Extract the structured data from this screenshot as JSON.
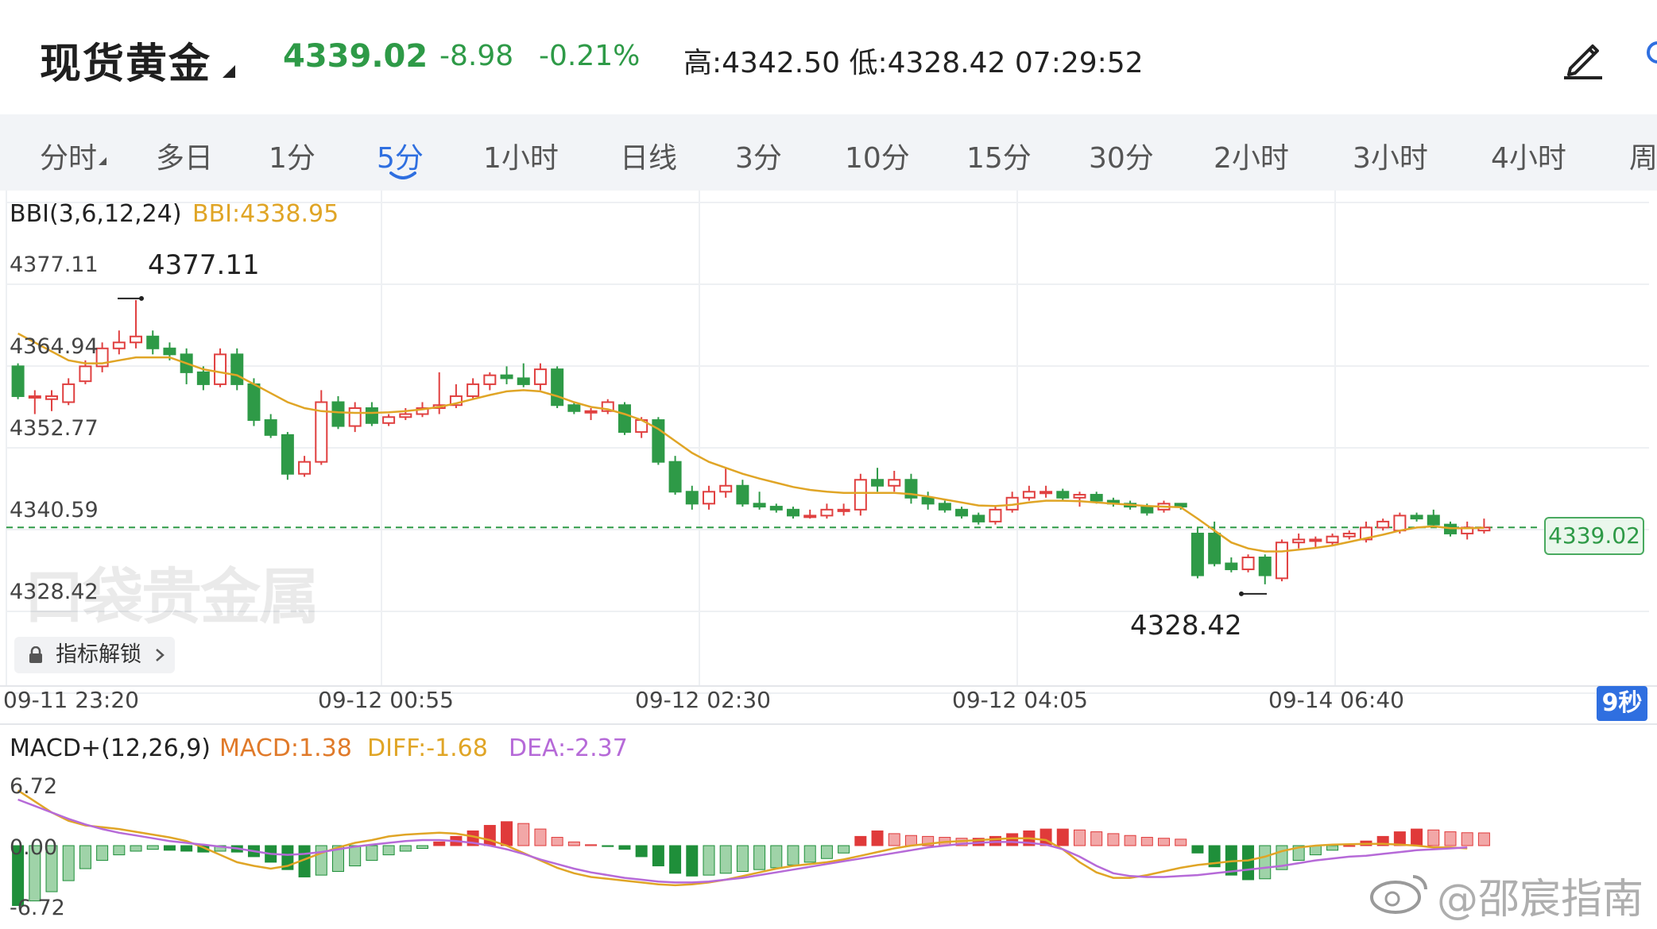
{
  "header": {
    "title": "现货黄金",
    "price": "4339.02",
    "change": "-8.98",
    "change_pct": "-0.21%",
    "high_low_time": "高:4342.50   低:4328.42   07:29:52",
    "colors": {
      "down": "#2e9a47",
      "up": "#e04040"
    }
  },
  "tabs": [
    "分时",
    "多日",
    "1分",
    "5分",
    "1小时",
    "日线",
    "3分",
    "10分",
    "15分",
    "30分",
    "2小时",
    "3小时",
    "4小时",
    "周"
  ],
  "active_tab": "5分",
  "indicator_unlock": "指标解锁",
  "current_price_tag": "4339.02",
  "refresh_badge": "9秒",
  "watermark": "口袋贵金属",
  "weibo_mark": "@邵宸指南",
  "chart_data": {
    "type": "candlestick",
    "bbi_label": "BBI(3,6,12,24)",
    "bbi_value": "BBI:4338.95",
    "y_ticks": [
      "4377.11",
      "4364.94",
      "4352.77",
      "4340.59",
      "4328.42"
    ],
    "ylim": [
      4322.3,
      4383.2
    ],
    "x_ticks": [
      "09-11 23:20",
      "09-12 00:55",
      "09-12 02:30",
      "09-12 04:05",
      "09-14 06:40"
    ],
    "high_label": "4377.11",
    "low_label": "4328.42",
    "last_price": 4339.02,
    "candles": [
      [
        4366,
        4361,
        4366.5,
        4360.5
      ],
      [
        4361,
        4361,
        4362,
        4358
      ],
      [
        4360.5,
        4361,
        4362,
        4358.5
      ],
      [
        4360,
        4363,
        4364,
        4359.5
      ],
      [
        4363.5,
        4366,
        4367,
        4363
      ],
      [
        4366,
        4369,
        4370,
        4365
      ],
      [
        4369,
        4370,
        4372,
        4368
      ],
      [
        4370,
        4371,
        4377.1,
        4369
      ],
      [
        4371,
        4369,
        4372,
        4368
      ],
      [
        4369,
        4368,
        4370,
        4367
      ],
      [
        4368,
        4365,
        4369,
        4363
      ],
      [
        4365,
        4363,
        4366,
        4362
      ],
      [
        4363,
        4368,
        4369,
        4362.5
      ],
      [
        4368,
        4363,
        4369,
        4362
      ],
      [
        4363,
        4357,
        4364,
        4356
      ],
      [
        4357,
        4354.5,
        4358,
        4354
      ],
      [
        4354.5,
        4348,
        4355,
        4347
      ],
      [
        4348,
        4350,
        4351,
        4347.5
      ],
      [
        4350,
        4360,
        4362,
        4349.5
      ],
      [
        4360,
        4356,
        4361,
        4355.5
      ],
      [
        4356,
        4359,
        4360,
        4355
      ],
      [
        4359,
        4356.5,
        4360,
        4356
      ],
      [
        4356.5,
        4357.5,
        4358,
        4356
      ],
      [
        4357.5,
        4358,
        4359,
        4357
      ],
      [
        4358,
        4359,
        4360,
        4357.5
      ],
      [
        4359,
        4359.5,
        4365,
        4358
      ],
      [
        4359.5,
        4361,
        4363,
        4359
      ],
      [
        4361,
        4363,
        4364,
        4360.5
      ],
      [
        4363,
        4364.5,
        4365,
        4362
      ],
      [
        4364.5,
        4364,
        4366,
        4363
      ],
      [
        4364,
        4363,
        4366.5,
        4362.5
      ],
      [
        4363,
        4365.5,
        4366.5,
        4362
      ],
      [
        4365.5,
        4359.5,
        4366,
        4359
      ],
      [
        4359.5,
        4358.5,
        4360,
        4358
      ],
      [
        4358.5,
        4358.5,
        4359,
        4357
      ],
      [
        4358.5,
        4360,
        4360.5,
        4358
      ],
      [
        4359.5,
        4355,
        4360,
        4354.5
      ],
      [
        4355,
        4357,
        4357.5,
        4354
      ],
      [
        4357,
        4350,
        4357.5,
        4349.5
      ],
      [
        4350,
        4345,
        4351,
        4344.5
      ],
      [
        4345,
        4343,
        4346,
        4342
      ],
      [
        4343,
        4345,
        4346,
        4342
      ],
      [
        4345,
        4346,
        4349,
        4344
      ],
      [
        4346,
        4343,
        4347,
        4342.5
      ],
      [
        4343,
        4342.5,
        4345,
        4342
      ],
      [
        4342.5,
        4342,
        4343,
        4341.5
      ],
      [
        4342,
        4341,
        4342.5,
        4340.5
      ],
      [
        4341,
        4341,
        4342,
        4340.5
      ],
      [
        4341,
        4342,
        4343,
        4340.5
      ],
      [
        4342,
        4342,
        4343,
        4341
      ],
      [
        4342,
        4347,
        4348,
        4341
      ],
      [
        4347,
        4346,
        4349,
        4345
      ],
      [
        4346,
        4347,
        4348.5,
        4345
      ],
      [
        4347,
        4344,
        4348,
        4343
      ],
      [
        4344,
        4343,
        4345,
        4342
      ],
      [
        4343,
        4342,
        4343.5,
        4341.5
      ],
      [
        4342,
        4341,
        4342.5,
        4340.5
      ],
      [
        4341,
        4340,
        4341.5,
        4339.5
      ],
      [
        4340,
        4342,
        4342.5,
        4339.5
      ],
      [
        4342,
        4344,
        4345,
        4341.5
      ],
      [
        4344,
        4345,
        4346,
        4343.5
      ],
      [
        4345,
        4345,
        4346,
        4344
      ],
      [
        4345,
        4344,
        4345.5,
        4343.5
      ],
      [
        4344,
        4344.5,
        4345,
        4342.5
      ],
      [
        4344.5,
        4343.5,
        4345,
        4343
      ],
      [
        4343.5,
        4343,
        4344,
        4342.5
      ],
      [
        4343,
        4342.5,
        4343.5,
        4342
      ],
      [
        4342.5,
        4341.5,
        4343,
        4341
      ],
      [
        4342,
        4343,
        4343.5,
        4341.5
      ],
      [
        4343,
        4342.5,
        4343,
        4342
      ],
      [
        4338,
        4331,
        4339,
        4330.5
      ],
      [
        4338,
        4333,
        4340,
        4332.5
      ],
      [
        4333,
        4332,
        4334,
        4331.5
      ],
      [
        4332,
        4334,
        4334.5,
        4331.5
      ],
      [
        4334,
        4331,
        4334.5,
        4329.5
      ],
      [
        4330.5,
        4336.5,
        4337,
        4330
      ],
      [
        4336.5,
        4337,
        4338,
        4335.5
      ],
      [
        4337,
        4337,
        4337.5,
        4335.5
      ],
      [
        4336.5,
        4337.5,
        4338,
        4336
      ],
      [
        4337.5,
        4338,
        4338.5,
        4337
      ],
      [
        4337,
        4339,
        4340,
        4336.5
      ],
      [
        4339,
        4340,
        4340.5,
        4338.5
      ],
      [
        4338.5,
        4341,
        4341.5,
        4338
      ],
      [
        4341,
        4340.5,
        4341.5,
        4340
      ],
      [
        4341,
        4339.5,
        4342,
        4339
      ],
      [
        4339.5,
        4338,
        4340,
        4337.5
      ],
      [
        4338,
        4339,
        4340,
        4337
      ],
      [
        4338.5,
        4339,
        4340.5,
        4338
      ]
    ],
    "bbi": [
      4371.5,
      4370,
      4368.5,
      4367,
      4366.5,
      4366.5,
      4367,
      4367.5,
      4367.5,
      4367.5,
      4366.5,
      4365.5,
      4365,
      4364.5,
      4363,
      4361.5,
      4360,
      4359,
      4358.5,
      4358.3,
      4358.2,
      4358.2,
      4358.3,
      4358.5,
      4358.8,
      4359.2,
      4359.8,
      4360.5,
      4361.2,
      4361.8,
      4362,
      4361.8,
      4361,
      4360,
      4359.2,
      4358.8,
      4358,
      4357,
      4355.5,
      4353.5,
      4351.5,
      4350,
      4349,
      4348,
      4347.2,
      4346.5,
      4345.8,
      4345.3,
      4345,
      4344.8,
      4344.8,
      4344.8,
      4344.8,
      4344.6,
      4344.2,
      4343.7,
      4343.2,
      4342.7,
      4342.6,
      4342.8,
      4343.2,
      4343.5,
      4343.5,
      4343.4,
      4343.2,
      4343,
      4342.8,
      4342.6,
      4342.5,
      4342.4,
      4340.5,
      4338.5,
      4336.5,
      4335.5,
      4335,
      4335,
      4335.3,
      4335.6,
      4336,
      4336.6,
      4337.2,
      4337.8,
      4338.5,
      4339,
      4339.2,
      4338.9,
      4338.9,
      4338.95
    ],
    "macd": {
      "label": "MACD+(12,26,9)",
      "macd_value": "MACD:1.38",
      "diff_value": "DIFF:-1.68",
      "dea_value": "DEA:-2.37",
      "y_ticks": [
        "6.72",
        "0.00",
        "-6.72"
      ],
      "ylim": [
        -6.72,
        6.72
      ],
      "hist": [
        -6.5,
        -6.0,
        -5.0,
        -3.8,
        -2.5,
        -1.6,
        -1.0,
        -0.6,
        -0.4,
        -0.5,
        -0.6,
        -0.7,
        -0.6,
        -0.7,
        -1.2,
        -1.8,
        -2.6,
        -3.4,
        -3.2,
        -2.8,
        -2.2,
        -1.6,
        -1.0,
        -0.6,
        -0.3,
        0.4,
        1.0,
        1.6,
        2.2,
        2.6,
        2.4,
        1.8,
        0.9,
        0.4,
        0.1,
        -0.1,
        -0.4,
        -1.2,
        -2.2,
        -3.0,
        -3.3,
        -3.2,
        -3.0,
        -2.8,
        -2.6,
        -2.4,
        -2.1,
        -1.8,
        -1.4,
        -0.8,
        1.0,
        1.6,
        1.3,
        1.1,
        1.0,
        0.9,
        0.8,
        0.8,
        1.0,
        1.3,
        1.6,
        1.8,
        1.8,
        1.7,
        1.5,
        1.3,
        1.1,
        0.9,
        0.8,
        0.7,
        -0.8,
        -2.3,
        -3.2,
        -3.7,
        -3.6,
        -2.6,
        -1.6,
        -1.0,
        -0.5,
        0.0,
        0.5,
        1.0,
        1.5,
        1.8,
        1.7,
        1.5,
        1.4,
        1.38
      ],
      "diff": [
        6.0,
        4.8,
        3.6,
        2.7,
        2.2,
        2.0,
        1.8,
        1.5,
        1.2,
        0.9,
        0.5,
        -0.2,
        -1.0,
        -1.8,
        -2.2,
        -2.5,
        -2.2,
        -1.5,
        -0.8,
        -0.2,
        0.3,
        0.6,
        1.0,
        1.2,
        1.3,
        1.4,
        1.3,
        1.0,
        0.6,
        0.0,
        -0.8,
        -1.6,
        -2.4,
        -3.0,
        -3.4,
        -3.6,
        -3.8,
        -4.0,
        -4.2,
        -4.3,
        -4.2,
        -4.0,
        -3.7,
        -3.3,
        -2.9,
        -2.5,
        -2.2,
        -2.0,
        -1.8,
        -1.5,
        -1.1,
        -0.7,
        -0.3,
        0.0,
        0.2,
        0.4,
        0.5,
        0.6,
        0.7,
        0.8,
        0.8,
        0.6,
        -0.4,
        -1.8,
        -2.9,
        -3.5,
        -3.5,
        -3.2,
        -2.8,
        -2.4,
        -2.1,
        -1.9,
        -1.7,
        -1.6,
        -1.2,
        -0.6,
        -0.2,
        0.0,
        0.1,
        0.15,
        0.2,
        0.2,
        0.1,
        0.0,
        -0.2,
        -0.2,
        -0.3,
        -1.68
      ],
      "dea": [
        5.0,
        4.3,
        3.6,
        2.9,
        2.3,
        1.8,
        1.4,
        1.1,
        0.8,
        0.5,
        0.3,
        0.1,
        -0.1,
        -0.3,
        -0.6,
        -0.9,
        -1.0,
        -0.9,
        -0.7,
        -0.4,
        -0.1,
        0.1,
        0.3,
        0.5,
        0.6,
        0.6,
        0.5,
        0.3,
        0.0,
        -0.4,
        -0.9,
        -1.5,
        -2.0,
        -2.5,
        -2.9,
        -3.2,
        -3.5,
        -3.7,
        -3.9,
        -4.0,
        -4.0,
        -3.9,
        -3.7,
        -3.5,
        -3.2,
        -2.9,
        -2.6,
        -2.3,
        -2.0,
        -1.7,
        -1.4,
        -1.1,
        -0.8,
        -0.5,
        -0.2,
        0.0,
        0.2,
        0.3,
        0.4,
        0.4,
        0.3,
        0.1,
        -0.4,
        -1.2,
        -2.2,
        -3.0,
        -3.3,
        -3.4,
        -3.4,
        -3.3,
        -3.2,
        -3.0,
        -2.8,
        -2.6,
        -2.4,
        -2.2,
        -1.9,
        -1.6,
        -1.4,
        -1.2,
        -1.1,
        -0.9,
        -0.7,
        -0.5,
        -0.4,
        -0.3,
        -0.2,
        -2.37
      ]
    }
  }
}
